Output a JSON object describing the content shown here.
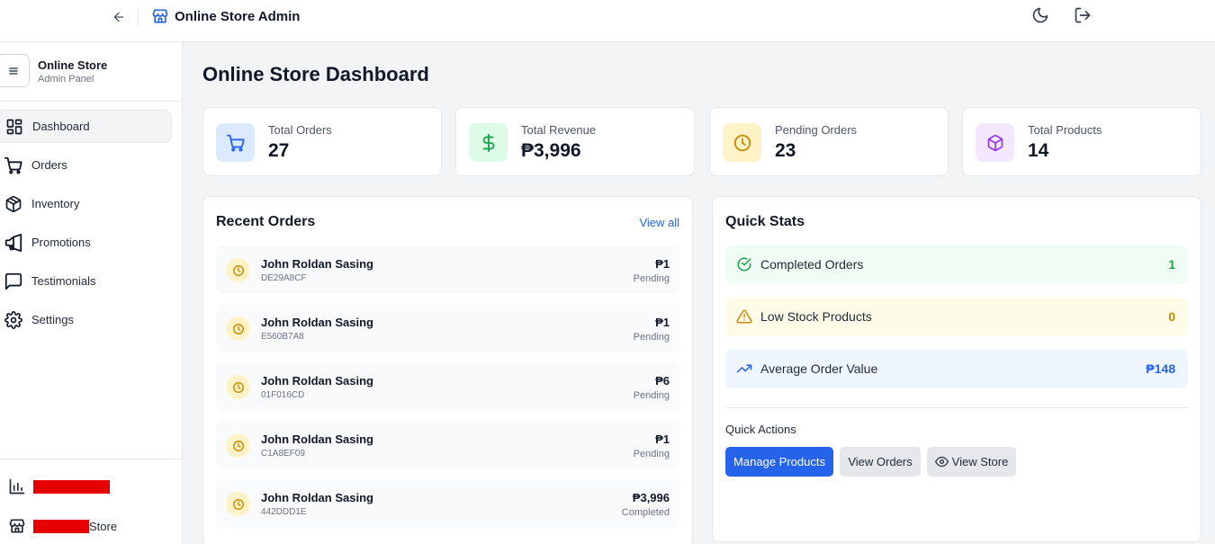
{
  "header": {
    "title": "Online Store Admin",
    "icons": {
      "back": "arrow-left-icon",
      "brand": "store-icon",
      "theme": "moon-icon",
      "logout": "logout-icon"
    }
  },
  "sidebar": {
    "brand_title": "Online Store",
    "brand_subtitle": "Admin Panel",
    "items": [
      {
        "label": "Dashboard",
        "icon": "dashboard-icon",
        "active": true
      },
      {
        "label": "Orders",
        "icon": "cart-icon"
      },
      {
        "label": "Inventory",
        "icon": "box-icon"
      },
      {
        "label": "Promotions",
        "icon": "megaphone-icon"
      },
      {
        "label": "Testimonials",
        "icon": "message-icon"
      },
      {
        "label": "Settings",
        "icon": "gear-icon"
      }
    ],
    "footer": [
      {
        "icon": "bar-chart-icon",
        "label": ""
      },
      {
        "icon": "store-icon",
        "label": "Store"
      }
    ]
  },
  "main": {
    "title": "Online Store Dashboard",
    "stats": [
      {
        "label": "Total Orders",
        "value": "27",
        "icon": "cart-icon",
        "color": "#2563eb",
        "bg": "#dbeafe"
      },
      {
        "label": "Total Revenue",
        "value": "₱3,996",
        "icon": "dollar-icon",
        "color": "#16a34a",
        "bg": "#dcfce7"
      },
      {
        "label": "Pending Orders",
        "value": "23",
        "icon": "clock-icon",
        "color": "#ca8a04",
        "bg": "#fef3c7"
      },
      {
        "label": "Total Products",
        "value": "14",
        "icon": "box-icon",
        "color": "#9333ea",
        "bg": "#f3e8ff"
      }
    ],
    "recent_orders": {
      "title": "Recent Orders",
      "view_all": "View all",
      "rows": [
        {
          "name": "John Roldan Sasing",
          "id": "DE29A8CF",
          "amount": "₱1",
          "status": "Pending"
        },
        {
          "name": "John Roldan Sasing",
          "id": "E560B7A8",
          "amount": "₱1",
          "status": "Pending"
        },
        {
          "name": "John Roldan Sasing",
          "id": "01F016CD",
          "amount": "₱6",
          "status": "Pending"
        },
        {
          "name": "John Roldan Sasing",
          "id": "C1A8EF09",
          "amount": "₱1",
          "status": "Pending"
        },
        {
          "name": "John Roldan Sasing",
          "id": "442DDD1E",
          "amount": "₱3,996",
          "status": "Completed"
        }
      ]
    },
    "quick_stats": {
      "title": "Quick Stats",
      "rows": [
        {
          "label": "Completed Orders",
          "value": "1",
          "icon": "check-circle-icon",
          "color": "#16a34a",
          "bg": "#f0fdf4"
        },
        {
          "label": "Low Stock Products",
          "value": "0",
          "icon": "warning-icon",
          "color": "#ca8a04",
          "bg": "#fefce8"
        },
        {
          "label": "Average Order Value",
          "value": "₱148",
          "icon": "trending-up-icon",
          "color": "#2563eb",
          "bg": "#eff6ff"
        }
      ],
      "actions_title": "Quick Actions",
      "actions": {
        "manage_products": "Manage Products",
        "view_orders": "View Orders",
        "view_store": "View Store"
      }
    }
  }
}
